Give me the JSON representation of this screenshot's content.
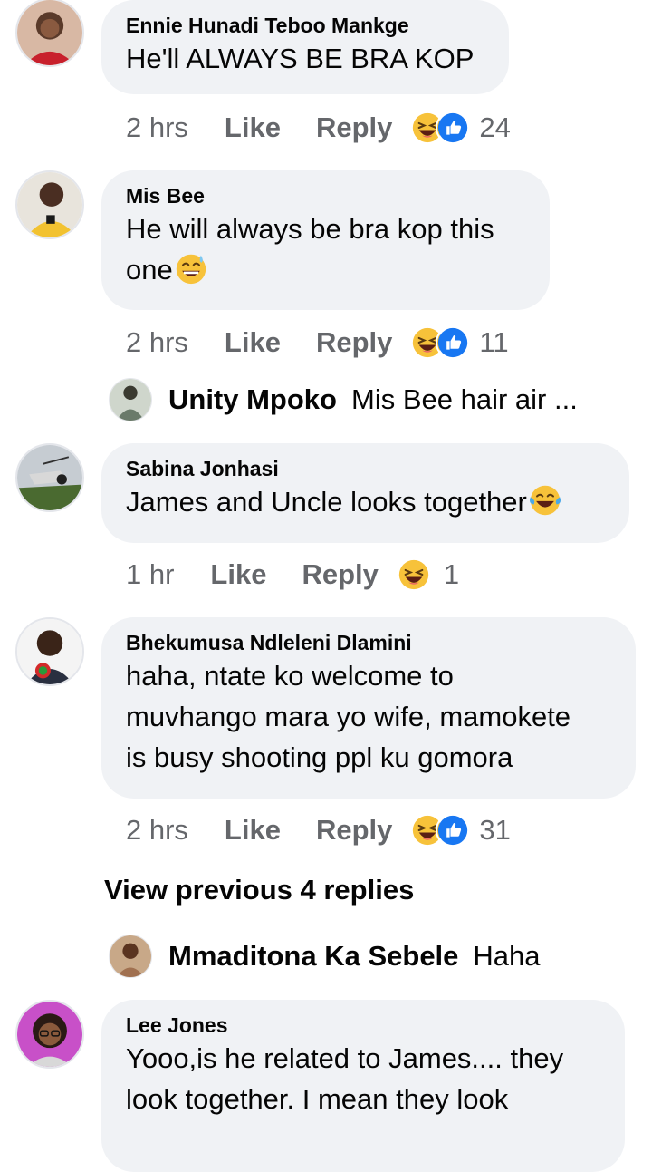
{
  "comments": [
    {
      "author": "Ennie Hunadi Teboo Mankge",
      "lines": [
        "He'll ALWAYS BE BRA KOP"
      ],
      "time": "2 hrs",
      "like": "Like",
      "reply": "Reply",
      "reactions": [
        "laughing",
        "like"
      ],
      "count": "24"
    },
    {
      "author": "Mis Bee",
      "lines": [
        "He will always be bra kop this",
        "one"
      ],
      "time": "2 hrs",
      "like": "Like",
      "reply": "Reply",
      "reactions": [
        "laughing",
        "like"
      ],
      "count": "11"
    },
    {
      "author": "Sabina Jonhasi",
      "lines": [
        "James and Uncle looks together"
      ],
      "time": "1 hr",
      "like": "Like",
      "reply": "Reply",
      "reactions": [
        "laughing"
      ],
      "count": "1"
    },
    {
      "author": "Bhekumusa Ndleleni Dlamini",
      "lines": [
        "haha, ntate ko welcome to",
        "muvhango mara yo wife, mamokete",
        "is busy shooting ppl ku gomora"
      ],
      "time": "2 hrs",
      "like": "Like",
      "reply": "Reply",
      "reactions": [
        "laughing",
        "like"
      ],
      "count": "31"
    },
    {
      "author": "Lee Jones",
      "lines": [
        "Yooo,is he related to James.... they",
        "look together. I mean they look"
      ]
    }
  ],
  "replies": [
    {
      "name": "Unity Mpoko",
      "text": "Mis Bee hair air ..."
    },
    {
      "name": "Mmaditona Ka Sebele",
      "text": "Haha"
    }
  ],
  "view_previous": "View previous 4 replies",
  "colors": {
    "bubble": "#f0f2f5",
    "meta": "#65676b",
    "like_blue": "#1877f2",
    "emoji_yellow": "#f7c23a"
  }
}
